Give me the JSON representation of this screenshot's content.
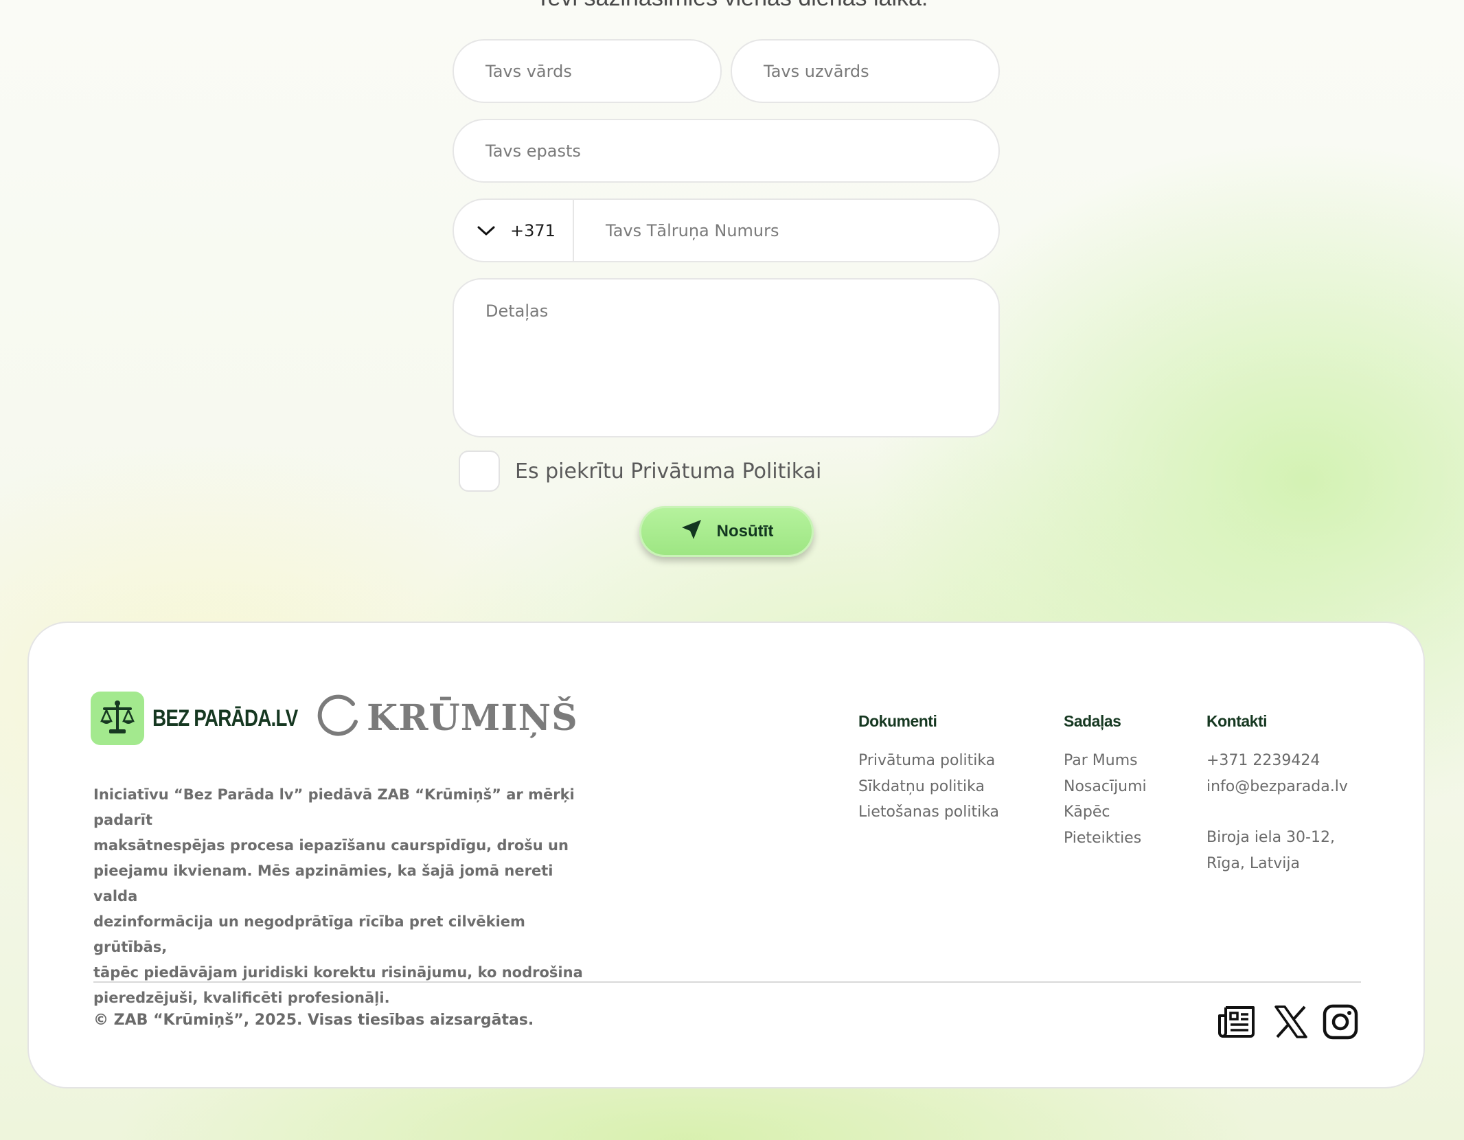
{
  "form": {
    "heading": "Tevi sazināsimies vienas dienas laikā.",
    "first_name_placeholder": "Tavs vārds",
    "last_name_placeholder": "Tavs uzvārds",
    "email_placeholder": "Tavs epasts",
    "phone_code": "+371",
    "phone_placeholder": "Tavs Tālruņa Numurs",
    "details_placeholder": "Detaļas",
    "consent_label": "Es piekrītu Privātuma Politikai",
    "submit_label": "Nosūtīt"
  },
  "footer": {
    "logo_bezparada": "BEZ PARĀDA.LV",
    "logo_krumins": "KRŪMIŅŠ",
    "about_lines": [
      "Iniciatīvu “Bez Parāda lv” piedāvā ZAB “Krūmiņš” ar mērķi padarīt",
      "maksātnespējas procesa iepazīšanu  caurspīdīgu, drošu un",
      "pieejamu ikvienam. Mēs apzināmies, ka šajā jomā nereti valda",
      "dezinformācija un negodprātīga rīcība pret cilvēkiem grūtībās,",
      "tāpēc piedāvājam juridiski korektu risinājumu, ko nodrošina",
      "pieredzējuši, kvalificēti profesionāļi."
    ],
    "dokumenti": {
      "title": "Dokumenti",
      "links": [
        "Privātuma politika",
        "Sīkdatņu politika",
        "Lietošanas politika"
      ]
    },
    "sadalas": {
      "title": "Sadaļas",
      "links": [
        "Par Mums",
        "Nosacījumi",
        "Kāpēc",
        "Pieteikties"
      ]
    },
    "kontakti": {
      "title": "Kontakti",
      "phone": "+371 2239424",
      "email": "info@bezparada.lv",
      "address_line1": "Biroja iela 30-12,",
      "address_line2": "Rīga, Latvija"
    },
    "copyright": "© ZAB “Krūmiņš”, 2025. Visas tiesības aizsargātas.",
    "social_icons": [
      "news-icon",
      "x-icon",
      "instagram-icon"
    ]
  },
  "colors": {
    "accent_green": "#a3e98e",
    "dark_green": "#163821",
    "muted_text": "#6a6a6a"
  }
}
